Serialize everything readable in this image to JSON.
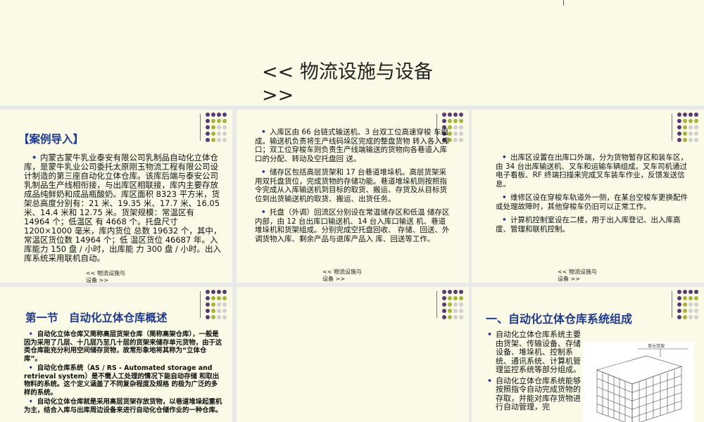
{
  "header": {
    "title": "<< 物流设施与设备 >>"
  },
  "slides": [
    {
      "heading": "【案例导入】",
      "bullets": [
        "内蒙古蒙牛乳业泰安有限公司乳制品自动化立体仓库，是蒙牛乳业公司委托太原刚玉物流工程有限公司设计制造的第三座自动化立体仓库。该库后端与泰安公司乳制品生产线相衔接，与出库区相联接，库内主要存放成品纯鲜奶和成品瓶酸奶。库区面积 8323 平方米，货架总高度分别有：21 米、19.35 米、17.7 米、16.05 米、14.4 米和 12.75 米。货架规模：常温区有 14964 个；低温区 有 4668 个。托盘尺寸 1200×1000 毫米，库内货位 总数 19632 个，其中，常温区货位数 14964 个；低 温区货位 46687 年。入库能力 150 盘 / 小时，出库能 力 300 盘 / 小时。出入库系统采用联机自动。"
      ],
      "footer": "<< 物流设施与设备 >>"
    },
    {
      "bullets": [
        "入库区由 66 台链式输送机、3 台双工位高速穿梭 车组成。输送机负责将生产线码垛区完成的整盘货物 转入各入库口；双工位穿梭车则负责生产线端输送的货物向各巷道入库口的分配、转动及空托盘回 送。",
        "储存区包括高层货架和 17 台巷道堆垛机。高层货架采用双托盘货位，完成货物的存储功能。巷道堆垛机则按照指令完成从入库输送机到目标的取货、搬运、存货及从目标货位到出货输送机的取货、搬运、出货任务。",
        "托盘（外调）回流区分别设在常温储存区和低温 储存区内部，由 12 台出库口输送机、14 台入库口输送 机、巷道堆垛机和货架组成。分别完成空托盘回收、 存储、回送、外调货物入库、剩余产品与退库产品入 库、回送等工作。"
      ],
      "footer": "<< 物流设施与设备 >>"
    },
    {
      "bullets": [
        "出库区设置在出库口外端，分为货物暂存区和装车区，由 34 台出库输送机、叉车和运输车辆组成。叉车司机通过电子看板、RF 终端扫描来完成叉车装车作业，反馈发送信息。",
        "维修区设在穿梭车轨道外一侧，在某台空梭车更换配件或处理故障时，其他穿梭车仍旧可以正常工作。",
        "计算机控制室设在二楼，用于出入库登记、出入库高度、管理和联机控制。"
      ],
      "footer": "<< 物流设施与设备 >>"
    },
    {
      "heading": "第一节　自动化立体仓库概述",
      "bullets": [
        "自动化立体仓库又简称高层货架仓库（简称高架仓库），一般是因为采用了几层、十几层乃至几十层的货架来储存单元货物，由于这类仓库能充分利用空间储存货物，故常形象地将其称为“立体仓库”。",
        "自动化仓库系统（AS / RS - Automated storage and retrieval system）是不需人工处理的情况下能自动存储 和取出物料的系统。这个定义涵盖了不同复杂程度及规格 的极为广泛的多样的系统。",
        "自动化立体仓库就是采用高层货架存放货物，以巷道堆垛起重机为主，结合入库与出库周边设备来进行自动化仓储作业的一种仓库。"
      ]
    },
    {},
    {
      "heading": "一、自动化立体仓库系统组成",
      "bullets": [
        "自动化立体仓库系统主要由货架、传输设备、存储设备、堆垛机、控制系统、通讯系统、计算机管理监控系统等部分组成。",
        "自动化立体仓库系统能够按照指令自动完成货物的存取，并能对库存货物进行自动管理，完"
      ],
      "diagram_label": "单元货架"
    }
  ],
  "colors": {
    "slide_bg": "#fafae6",
    "gap_bg": "#e9e9e9",
    "heading": "#1f3a8f",
    "dot_purple": "#5b3a72",
    "dot_olive": "#a8b33c",
    "dot_grey": "#cfcfcf"
  }
}
